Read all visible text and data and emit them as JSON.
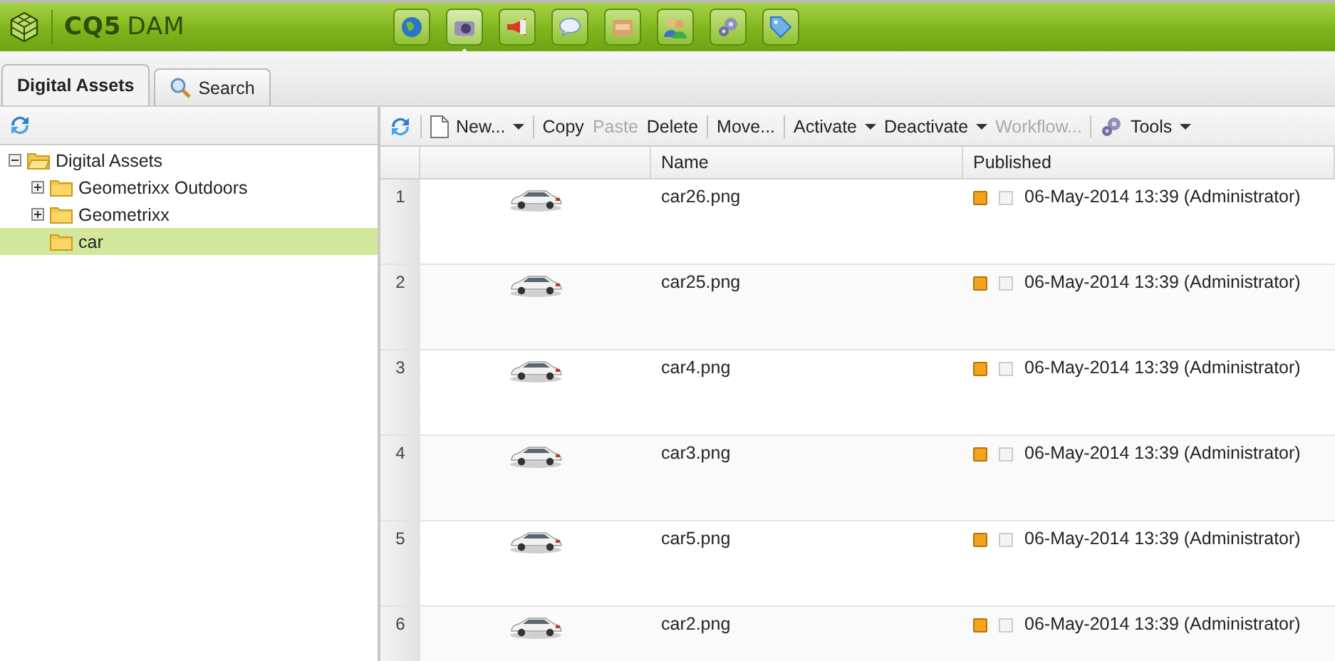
{
  "header": {
    "brand_bold": "CQ5",
    "brand_light": "DAM",
    "nav": [
      {
        "selected": false
      },
      {
        "selected": true
      },
      {
        "selected": false
      },
      {
        "selected": false
      },
      {
        "selected": false
      },
      {
        "selected": false
      },
      {
        "selected": false
      },
      {
        "selected": false
      }
    ]
  },
  "tabs": [
    {
      "label": "Digital Assets",
      "selected": true
    },
    {
      "label": "Search",
      "selected": false
    }
  ],
  "tree": [
    {
      "label": "Digital Assets",
      "expanded": true,
      "selected": false,
      "children": [
        {
          "label": "Geometrixx Outdoors",
          "expanded": false,
          "selected": false
        },
        {
          "label": "Geometrixx",
          "expanded": false,
          "selected": false
        },
        {
          "label": "car",
          "selected": true
        }
      ]
    }
  ],
  "toolbar": [
    {
      "kind": "refresh"
    },
    {
      "kind": "sep"
    },
    {
      "kind": "new",
      "label": "New...",
      "menu": true,
      "disabled": false
    },
    {
      "kind": "sep"
    },
    {
      "kind": "button",
      "label": "Copy",
      "menu": false,
      "disabled": false
    },
    {
      "kind": "button",
      "label": "Paste",
      "menu": false,
      "disabled": true
    },
    {
      "kind": "button",
      "label": "Delete",
      "menu": false,
      "disabled": false
    },
    {
      "kind": "sep"
    },
    {
      "kind": "button",
      "label": "Move...",
      "menu": false,
      "disabled": false
    },
    {
      "kind": "sep"
    },
    {
      "kind": "button",
      "label": "Activate",
      "menu": true,
      "disabled": false
    },
    {
      "kind": "button",
      "label": "Deactivate",
      "menu": true,
      "disabled": false
    },
    {
      "kind": "button",
      "label": "Workflow...",
      "menu": false,
      "disabled": true
    },
    {
      "kind": "sep"
    },
    {
      "kind": "tools",
      "label": "Tools",
      "menu": true,
      "disabled": false
    }
  ],
  "table": {
    "columns": [
      "Name",
      "Published"
    ],
    "rows": [
      {
        "number": "1",
        "name": "car26.png",
        "color": "#f5a31d",
        "checked": false,
        "published": "06-May-2014 13:39 (Administrator)"
      },
      {
        "number": "2",
        "name": "car25.png",
        "color": "#f5a31d",
        "checked": false,
        "published": "06-May-2014 13:39 (Administrator)"
      },
      {
        "number": "3",
        "name": "car4.png",
        "color": "#f5a31d",
        "checked": false,
        "published": "06-May-2014 13:39 (Administrator)"
      },
      {
        "number": "4",
        "name": "car3.png",
        "color": "#f5a31d",
        "checked": false,
        "published": "06-May-2014 13:39 (Administrator)"
      },
      {
        "number": "5",
        "name": "car5.png",
        "color": "#f5a31d",
        "checked": false,
        "published": "06-May-2014 13:39 (Administrator)"
      },
      {
        "number": "6",
        "name": "car2.png",
        "color": "#f5a31d",
        "checked": false,
        "published": "06-May-2014 13:39 (Administrator)"
      }
    ]
  }
}
